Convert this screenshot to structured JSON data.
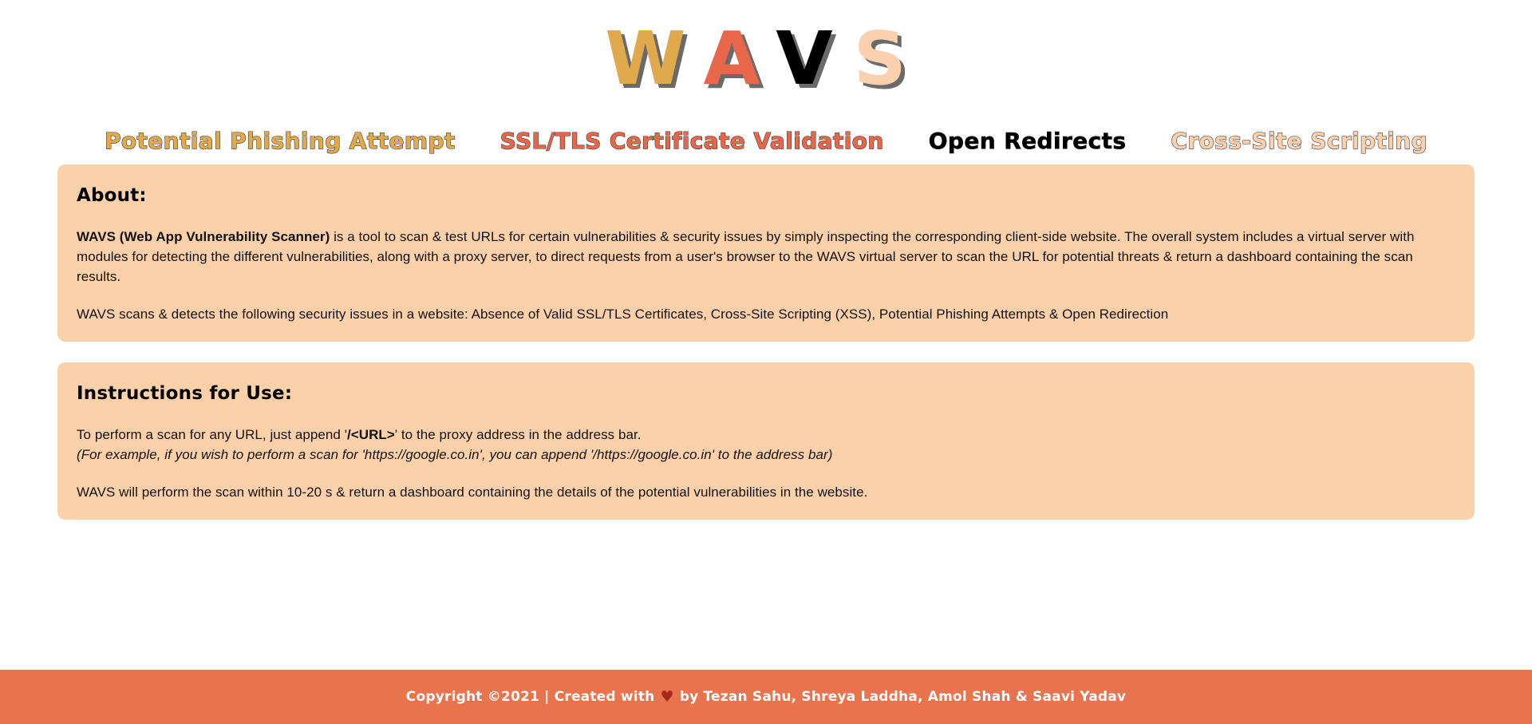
{
  "logo": {
    "letters": [
      {
        "char": "W",
        "color": "#E0A94B"
      },
      {
        "char": "A",
        "color": "#E8674A"
      },
      {
        "char": "V",
        "color": "#000000"
      },
      {
        "char": "S",
        "color": "#FBD0AE"
      }
    ],
    "text": "WAVS"
  },
  "nav": {
    "tabs": [
      {
        "label": "Potential Phishing Attempt",
        "color": "#E0A94B",
        "active": false
      },
      {
        "label": "SSL/TLS Certificate Validation",
        "color": "#E8674A",
        "active": false
      },
      {
        "label": "Open Redirects",
        "color": "#000000",
        "active": true
      },
      {
        "label": "Cross-Site Scripting",
        "color": "#FBD0AE",
        "active": false
      }
    ]
  },
  "about": {
    "heading": "About:",
    "para1_bold": "WAVS (Web App Vulnerability Scanner)",
    "para1_rest": " is a tool to scan & test URLs for certain vulnerabilities & security issues by simply inspecting the corresponding client-side website. The overall system includes a virtual server with modules for detecting the different vulnerabilities, along with a proxy server, to direct requests from a user's browser to the WAVS virtual server to scan the URL for potential threats & return a dashboard containing the scan results.",
    "para2": "WAVS scans & detects the following security issues in a website: Absence of Valid SSL/TLS Certificates, Cross-Site Scripting (XSS), Potential Phishing Attempts & Open Redirection"
  },
  "instructions": {
    "heading": "Instructions for Use:",
    "line1_pre": "To perform a scan for any URL, just append '",
    "line1_code": "/<URL>",
    "line1_post": "' to the proxy address in the address bar.",
    "line2_italic": "(For example, if you wish to perform a scan for 'https://google.co.in', you can append '/https://google.co.in' to the address bar)",
    "line3": "WAVS will perform the scan within 10-20 s & return a dashboard containing the details of the potential vulnerabilities in the website."
  },
  "footer": {
    "pre": "Copyright ©2021 | Created with",
    "heart": "♥",
    "post": "by Tezan Sahu, Shreya Laddha, Amol Shah & Saavi Yadav"
  },
  "colors": {
    "panel_bg": "#FCD0A8",
    "footer_bg": "#E8734C",
    "heart": "#A52A16",
    "page_bg": "#FFFFFF"
  }
}
